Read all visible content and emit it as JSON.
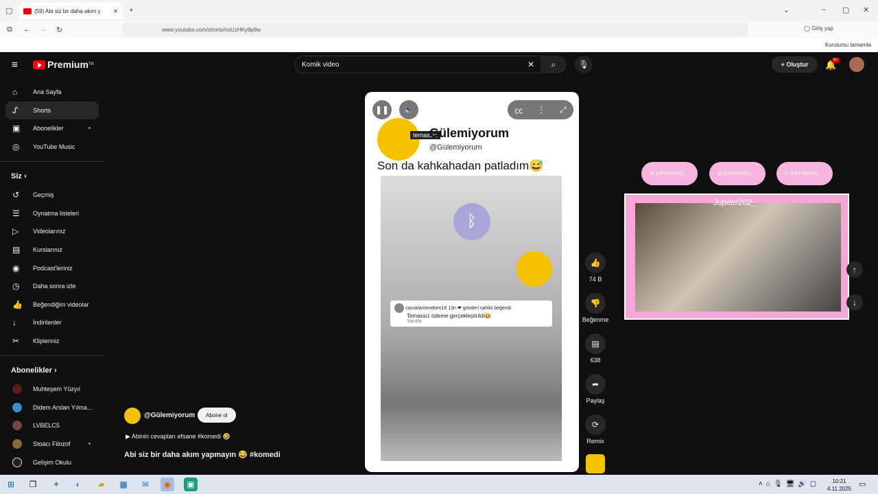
{
  "browser": {
    "tab_title": "(59) Abi siz bir daha akım y",
    "url": "www.youtube.com/shorts/noUzHKy8p6w",
    "signin": "Giriş yap",
    "install_status": "Kurulumu tamamla"
  },
  "youtube": {
    "logo_text": "Premium",
    "logo_sup": "TR",
    "search_value": "Komik video",
    "create_label": "Oluştur",
    "notifications": "9+"
  },
  "sidebar": {
    "main": [
      "Ana Sayfa",
      "Shorts",
      "Abonelikler",
      "YouTube Music"
    ],
    "you_header": "Siz",
    "you": [
      "Geçmiş",
      "Oynatma listeleri",
      "Videolarınız",
      "Kurslarınız",
      "Podcast'leriniz",
      "Daha sonra izle",
      "Beğendiğim videolar",
      "İndirilenler",
      "Klipleriniz"
    ],
    "subs_header": "Abonelikler",
    "subs": [
      "Muhteşem Yüzyıl",
      "Didem Arslan Yılma...",
      "LVBELC5",
      "Stoacı Filozof",
      "Gelişim Okulu"
    ]
  },
  "short": {
    "channel_name": "Gülemiyorum",
    "channel_handle": "@Gülemiyorum",
    "overlay_label": "temassız",
    "caption": "Son da kahkahadan patladım😅",
    "comment_user": "cocuklarimveben18",
    "comment_time": "13n",
    "comment_liked": "gönderi sahibi beğendi",
    "comment_text": "Temassız ödeme gerçekleştirildi😂",
    "comment_reply": "Yanıtla"
  },
  "info": {
    "handle": "@Gülemiyorum",
    "subscribe": "Abone ol",
    "desc": "▶ Abinin cevapları efsane #komedi 🤣",
    "title": "Abi siz bir daha akım yapmayın 😂 #komedi"
  },
  "actions": {
    "likes": "74 B",
    "dislike": "Beğenme",
    "comments": "638",
    "share": "Paylaş",
    "remix": "Remix"
  },
  "stream": {
    "name": "Jupiter202_",
    "socials": [
      "JUPITER202_",
      "JUPITER202_",
      "JUPITER202_"
    ]
  },
  "taskbar": {
    "time": "10:21",
    "date": "4.11.2025"
  }
}
